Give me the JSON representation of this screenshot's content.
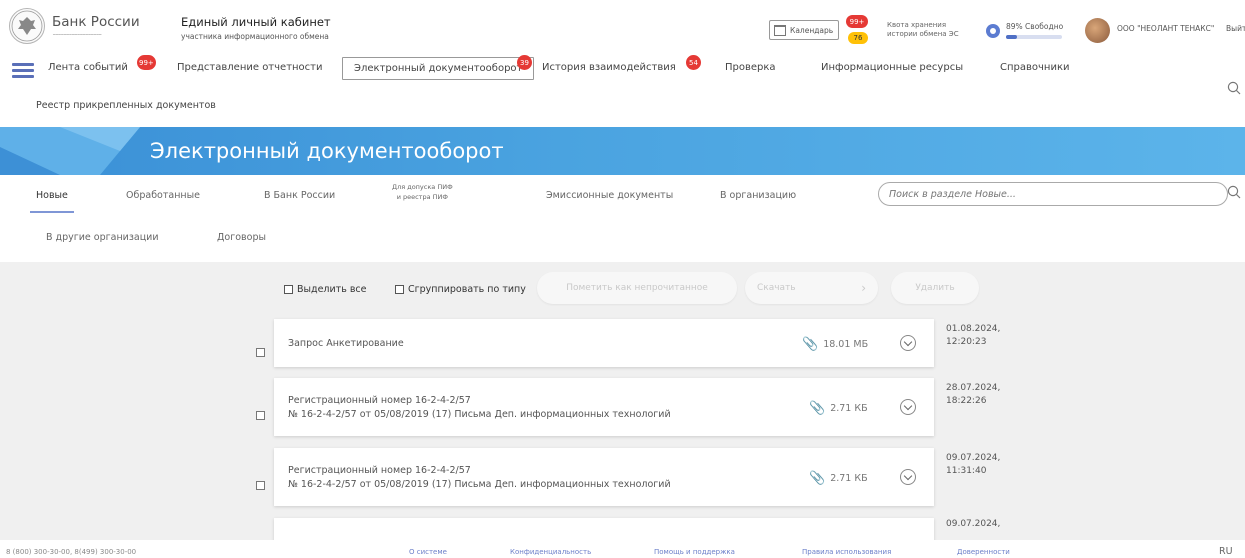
{
  "header": {
    "logo_text": "Банк России",
    "cabinet_title": "Единый личный кабинет",
    "cabinet_subtitle": "участника информационного обмена",
    "calendar_label": "Календарь",
    "calendar_badge_red": "99+",
    "calendar_badge_yellow": "76",
    "quota_line1": "Квота хранения",
    "quota_line2": "истории обмена ЭС",
    "quota_free": "89% Свободно",
    "quota_free_fraction": 0.89,
    "org_name": "ООО \"НЕОЛАНТ ТЕНАКС\"",
    "logout": "Выйти"
  },
  "nav": {
    "items": [
      {
        "label": "Лента событий",
        "badge": "99+"
      },
      {
        "label": "Представление отчетности",
        "badge": ""
      },
      {
        "label": "Электронный документооборот",
        "badge": "39"
      },
      {
        "label": "История взаимодействия",
        "badge": "54"
      },
      {
        "label": "Проверка",
        "badge": ""
      },
      {
        "label": "Информационные ресурсы",
        "badge": ""
      },
      {
        "label": "Справочники",
        "badge": ""
      }
    ],
    "sub_item": "Реестр прикрепленных документов"
  },
  "banner": {
    "title": "Электронный документооборот"
  },
  "tabs": {
    "items": [
      "Новые",
      "Обработанные",
      "В Банк России",
      "Эмиссионные документы",
      "В организацию"
    ],
    "small_tab_line1": "Для допуска ПИФ",
    "small_tab_line2": "и реестра ПИФ",
    "row2": [
      "В другие организации",
      "Договоры"
    ],
    "search_placeholder": "Поиск в разделе Новые..."
  },
  "toolbar": {
    "select_all": "Выделить все",
    "group_by_type": "Сгруппировать по типу",
    "mark_unread": "Пометить как непрочитанное",
    "download": "Скачать",
    "delete": "Удалить"
  },
  "documents": [
    {
      "title": "Запрос Анкетирование",
      "subtitle": "",
      "size": "18.01 МБ",
      "date": "01.08.2024,",
      "time": "12:20:23"
    },
    {
      "title": "Регистрационный номер 16-2-4-2/57",
      "subtitle": "№ 16-2-4-2/57 от 05/08/2019 (17) Письма Деп. информационных технологий",
      "size": "2.71 КБ",
      "date": "28.07.2024,",
      "time": "18:22:26"
    },
    {
      "title": "Регистрационный номер 16-2-4-2/57",
      "subtitle": "№ 16-2-4-2/57 от 05/08/2019 (17) Письма Деп. информационных технологий",
      "size": "2.71 КБ",
      "date": "09.07.2024,",
      "time": "11:31:40"
    },
    {
      "title": "",
      "subtitle": "",
      "size": "",
      "date": "09.07.2024,",
      "time": ""
    }
  ],
  "footer": {
    "phone": "8 (800) 300-30-00, 8(499) 300-30-00",
    "links": [
      "О системе",
      "Конфиденциальность",
      "Помощь и поддержка",
      "Правила использования",
      "Доверенности"
    ],
    "lang": "RU"
  },
  "colors": {
    "accent": "#5a6fb8",
    "badge_red": "#e53935",
    "badge_yellow": "#ffc107",
    "banner": "#4aa3e0"
  }
}
